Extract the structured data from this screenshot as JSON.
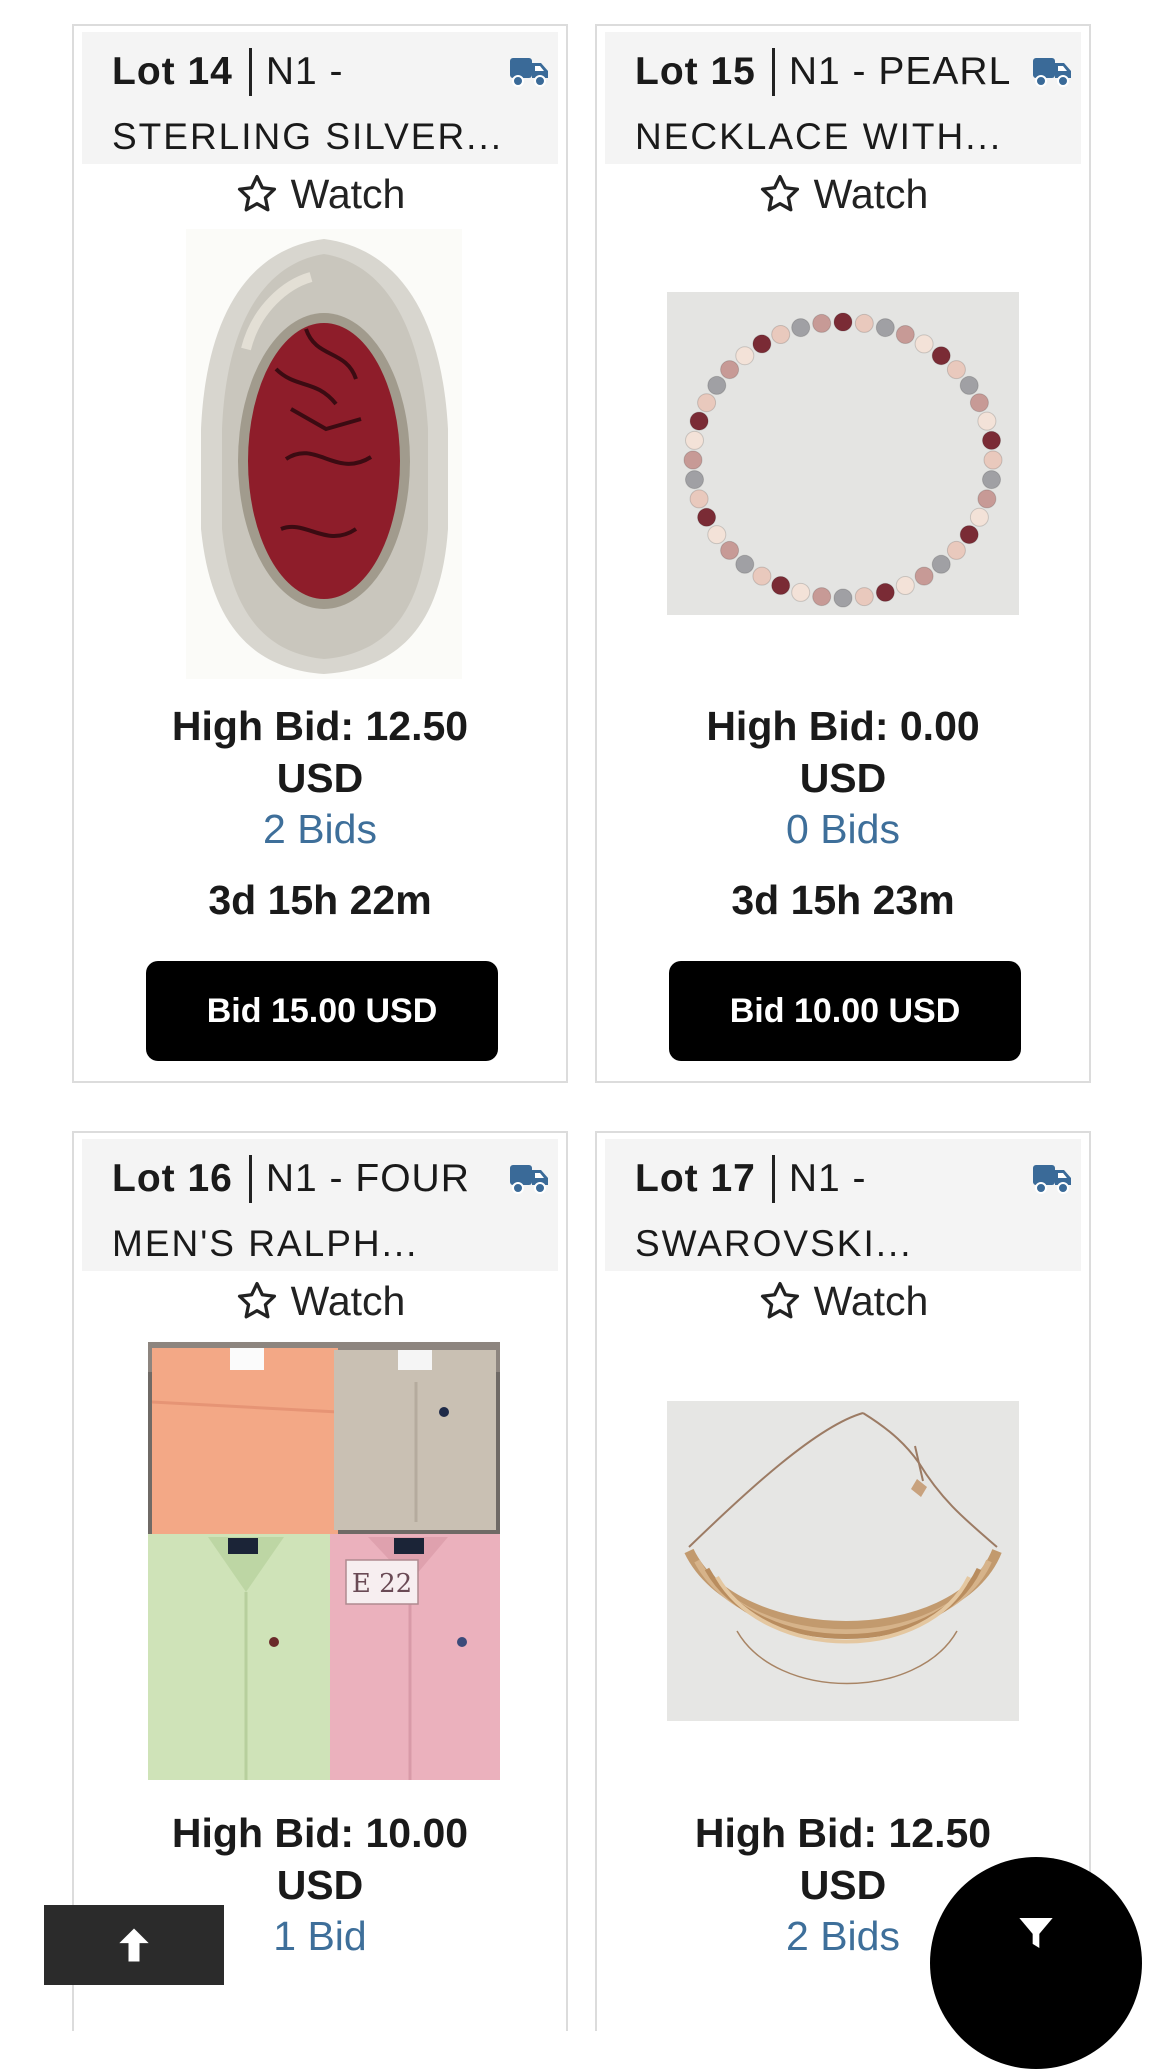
{
  "lots": [
    {
      "lot_label": "Lot 14",
      "title_line1": "N1 -",
      "title_line2": "STERLING SILVER...",
      "watch_label": "Watch",
      "high_bid_line1": "High Bid: 12.50",
      "high_bid_line2": "USD",
      "bids": "2 Bids",
      "time_left": "3d 15h 22m",
      "bid_button": "Bid 15.00 USD"
    },
    {
      "lot_label": "Lot 15",
      "title_line1": "N1 - PEARL",
      "title_line2": "NECKLACE WITH...",
      "watch_label": "Watch",
      "high_bid_line1": "High Bid: 0.00",
      "high_bid_line2": "USD",
      "bids": "0 Bids",
      "time_left": "3d 15h 23m",
      "bid_button": "Bid 10.00 USD"
    },
    {
      "lot_label": "Lot 16",
      "title_line1": "N1 - FOUR",
      "title_line2": "MEN'S RALPH...",
      "watch_label": "Watch",
      "photo_tag": "E 22",
      "high_bid_line1": "High Bid: 10.00",
      "high_bid_line2": "USD",
      "bids": "1 Bid"
    },
    {
      "lot_label": "Lot 17",
      "title_line1": "N1 -",
      "title_line2": "SWAROVSKI...",
      "watch_label": "Watch",
      "high_bid_line1": "High Bid: 12.50",
      "high_bid_line2": "USD",
      "bids": "2 Bids"
    }
  ],
  "icons": {
    "shipping": "truck-icon",
    "watch": "star-outline-icon",
    "scroll_top": "arrow-up-icon",
    "filter": "filter-icon"
  },
  "colors": {
    "bid_count_link": "#3e6f9a",
    "truck_icon": "#3a6a98",
    "bid_button_bg": "#000000",
    "header_bg": "#f4f4f4"
  }
}
